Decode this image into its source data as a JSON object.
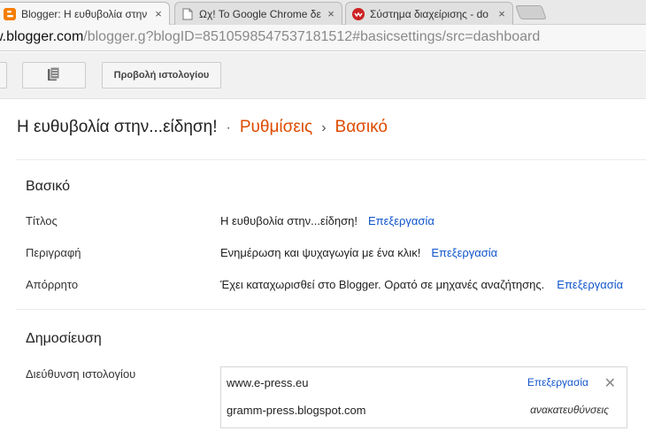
{
  "browser": {
    "tabs": [
      {
        "title": "Blogger: Η ευθυβολία στην",
        "close": "×",
        "icon": "blogger-favicon",
        "active": true
      },
      {
        "title": "Ωχ! Το Google Chrome δε",
        "close": "×",
        "icon": "page-icon",
        "active": false
      },
      {
        "title": "Σύστημα διαχείρισης - do",
        "close": "×",
        "icon": "joomla-favicon",
        "active": false
      }
    ],
    "url_host": "w.blogger.com",
    "url_path": "/blogger.g?blogID=8510598547537181512#basicsettings/src=dashboard"
  },
  "toolbar": {
    "view_blog_label": "Προβολή ιστολογίου",
    "icons": [
      "pages-icon"
    ]
  },
  "breadcrumb": {
    "blog_name": "Η ευθυβολία στην...είδηση!",
    "separator1": "·",
    "settings": "Ρυθμίσεις",
    "separator2": "›",
    "current": "Βασικό"
  },
  "basic": {
    "heading": "Βασικό",
    "rows": [
      {
        "label": "Τίτλος",
        "value": "Η ευθυβολία στην...είδηση!",
        "action": "Επεξεργασία"
      },
      {
        "label": "Περιγραφή",
        "value": "Ενημέρωση και ψυχαγωγία με ένα κλικ!",
        "action": "Επεξεργασία"
      },
      {
        "label": "Απόρρητο",
        "value": "Έχει καταχωρισθεί στο Blogger. Ορατό σε μηχανές αναζήτησης.",
        "action": "Επεξεργασία"
      }
    ]
  },
  "publishing": {
    "heading": "Δημοσίευση",
    "address_label": "Διεύθυνση ιστολογίου",
    "custom_domain": "www.e-press.eu",
    "edit": "Επεξεργασία",
    "remove": "✕",
    "blogspot": "gramm-press.blogspot.com",
    "redirect": "ανακατευθύνσεις"
  },
  "colors": {
    "accent_orange": "#dd4b00",
    "link_blue": "#1155cc"
  }
}
